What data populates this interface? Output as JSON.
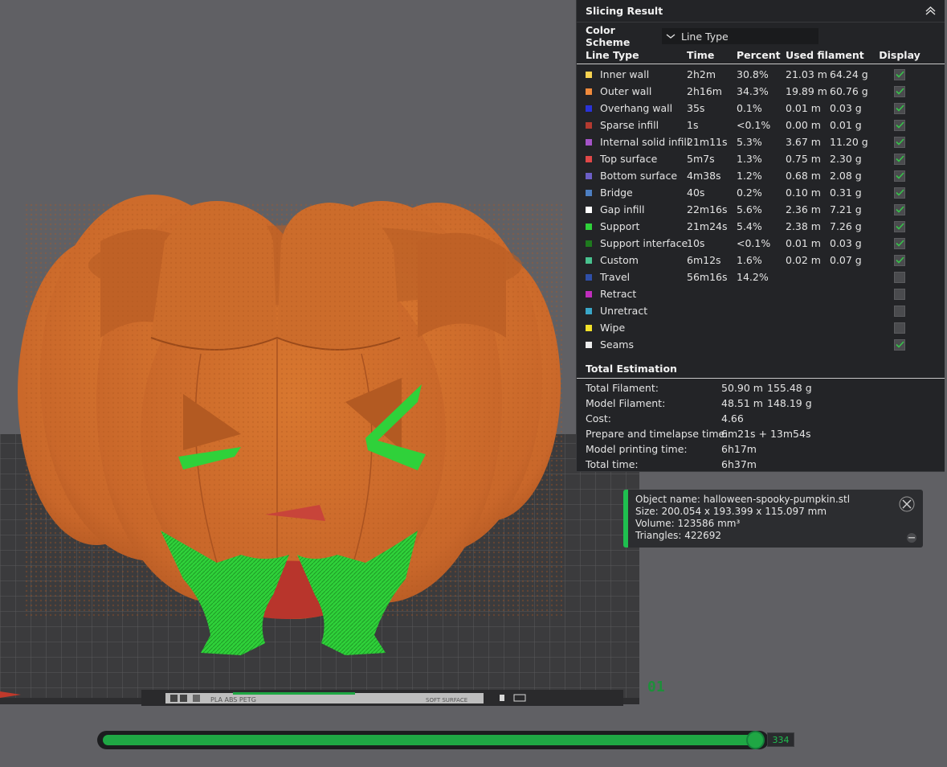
{
  "slicing_result": {
    "title": "Slicing Result",
    "color_scheme_label": "Color Scheme",
    "color_scheme_value": "Line Type",
    "columns": [
      "Line Type",
      "Time",
      "Percent",
      "Used filament",
      "Display"
    ],
    "rows": [
      {
        "name": "Inner wall",
        "color": "#f7d251",
        "time": "2h2m",
        "percent": "30.8%",
        "length": "21.03 m",
        "weight": "64.24 g",
        "display": true
      },
      {
        "name": "Outer wall",
        "color": "#f08a3c",
        "time": "2h16m",
        "percent": "34.3%",
        "length": "19.89 m",
        "weight": "60.76 g",
        "display": true
      },
      {
        "name": "Overhang wall",
        "color": "#2a33d8",
        "time": "35s",
        "percent": "0.1%",
        "length": "0.01 m",
        "weight": "0.03 g",
        "display": true
      },
      {
        "name": "Sparse infill",
        "color": "#b33a30",
        "time": "1s",
        "percent": "<0.1%",
        "length": "0.00 m",
        "weight": "0.01 g",
        "display": true
      },
      {
        "name": "Internal solid infill",
        "color": "#a554c8",
        "time": "21m11s",
        "percent": "5.3%",
        "length": "3.67 m",
        "weight": "11.20 g",
        "display": true
      },
      {
        "name": "Top surface",
        "color": "#e04848",
        "time": "5m7s",
        "percent": "1.3%",
        "length": "0.75 m",
        "weight": "2.30 g",
        "display": true
      },
      {
        "name": "Bottom surface",
        "color": "#6c5fc6",
        "time": "4m38s",
        "percent": "1.2%",
        "length": "0.68 m",
        "weight": "2.08 g",
        "display": true
      },
      {
        "name": "Bridge",
        "color": "#4d7fc2",
        "time": "40s",
        "percent": "0.2%",
        "length": "0.10 m",
        "weight": "0.31 g",
        "display": true
      },
      {
        "name": "Gap infill",
        "color": "#ffffff",
        "time": "22m16s",
        "percent": "5.6%",
        "length": "2.36 m",
        "weight": "7.21 g",
        "display": true
      },
      {
        "name": "Support",
        "color": "#2fd13a",
        "time": "21m24s",
        "percent": "5.4%",
        "length": "2.38 m",
        "weight": "7.26 g",
        "display": true
      },
      {
        "name": "Support interface",
        "color": "#1e7a1e",
        "time": "10s",
        "percent": "<0.1%",
        "length": "0.01 m",
        "weight": "0.03 g",
        "display": true
      },
      {
        "name": "Custom",
        "color": "#49c28f",
        "time": "6m12s",
        "percent": "1.6%",
        "length": "0.02 m",
        "weight": "0.07 g",
        "display": true
      },
      {
        "name": "Travel",
        "color": "#2f4fa8",
        "time": "56m16s",
        "percent": "14.2%",
        "length": "",
        "weight": "",
        "display": false
      },
      {
        "name": "Retract",
        "color": "#c02dbd",
        "time": "",
        "percent": "",
        "length": "",
        "weight": "",
        "display": false
      },
      {
        "name": "Unretract",
        "color": "#3aa7c9",
        "time": "",
        "percent": "",
        "length": "",
        "weight": "",
        "display": false
      },
      {
        "name": "Wipe",
        "color": "#f2e12a",
        "time": "",
        "percent": "",
        "length": "",
        "weight": "",
        "display": false
      },
      {
        "name": "Seams",
        "color": "#ededed",
        "time": "",
        "percent": "",
        "length": "",
        "weight": "",
        "display": true
      }
    ],
    "total_estimation": {
      "title": "Total Estimation",
      "rows": [
        {
          "label": "Total Filament:",
          "v1": "50.90 m",
          "v2": "155.48 g"
        },
        {
          "label": "Model Filament:",
          "v1": "48.51 m",
          "v2": "148.19 g"
        },
        {
          "label": "Cost:",
          "v1": "4.66",
          "v2": ""
        },
        {
          "label": "Prepare and timelapse time:",
          "v1": "6m21s + 13m54s",
          "v2": ""
        },
        {
          "label": "Model printing time:",
          "v1": "6h17m",
          "v2": ""
        },
        {
          "label": "Total time:",
          "v1": "6h37m",
          "v2": ""
        }
      ]
    }
  },
  "object_info": {
    "name": "Object name: halloween-spooky-pumpkin.stl",
    "size": "Size: 200.054 x 193.399 x 115.097 mm",
    "volume": "Volume: 123586 mm³",
    "triangles": "Triangles: 422692"
  },
  "plate": {
    "number": "01",
    "filament_types": "PLA ABS PETG",
    "surface_label": "SOFT SURFACE"
  },
  "layer_slider": {
    "value": "334",
    "position": 1.0
  },
  "colors": {
    "pumpkin": "#c9672a",
    "support": "#2fd13a",
    "accent": "#1fa744",
    "panel": "#232427"
  }
}
